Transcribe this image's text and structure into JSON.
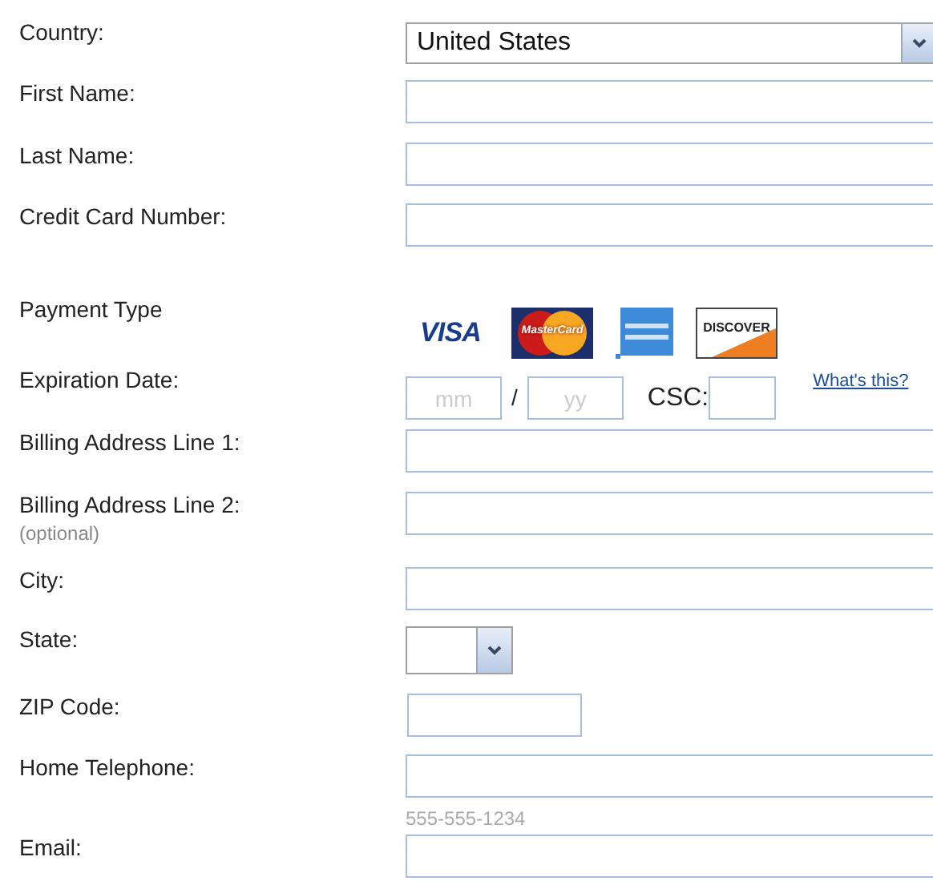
{
  "rows": [
    {
      "kind": "select",
      "label": "Country:",
      "value": "United States"
    },
    {
      "kind": "text",
      "label": "First Name:"
    },
    {
      "kind": "text",
      "label": "Last Name:"
    },
    {
      "kind": "text",
      "label": "Credit Card Number:"
    },
    {
      "kind": "cards",
      "label": "Payment Type",
      "cards": [
        {
          "kind": "visa",
          "label": "VISA"
        },
        {
          "kind": "mastercard",
          "label": "MasterCard"
        },
        {
          "kind": "amex"
        },
        {
          "kind": "discover",
          "label": "DISCOVER"
        }
      ]
    },
    {
      "kind": "expiry",
      "label": "Expiration Date:",
      "month_placeholder": "mm",
      "separator": "/",
      "year_placeholder": "yy",
      "csc_label": "CSC:",
      "link": "What's this?"
    },
    {
      "kind": "text",
      "label": "Billing Address Line 1:"
    },
    {
      "kind": "text",
      "label": "Billing Address Line 2:",
      "note": "(optional)"
    },
    {
      "kind": "text",
      "label": "City:"
    },
    {
      "kind": "small_select",
      "label": "State:"
    },
    {
      "kind": "short",
      "label": "ZIP Code:"
    },
    {
      "kind": "text",
      "label": "Home Telephone:",
      "hint": "555-555-1234"
    },
    {
      "kind": "text",
      "label": "Email:"
    }
  ]
}
